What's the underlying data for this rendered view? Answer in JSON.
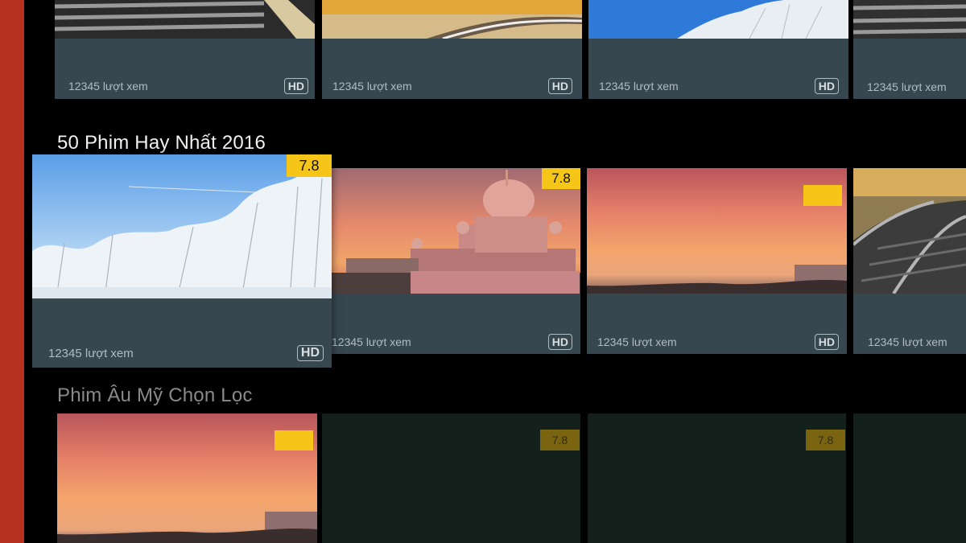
{
  "row0": {
    "cards": [
      {
        "views": "12345 lượt xem",
        "badge": "HD"
      },
      {
        "views": "12345 lượt xem",
        "badge": "HD"
      },
      {
        "views": "12345 lượt xem",
        "badge": "HD"
      },
      {
        "views": "12345 lượt xem"
      }
    ]
  },
  "row1": {
    "title": "50 Phim Hay Nhất 2016",
    "cards": [
      {
        "views": "12345 lượt xem",
        "badge": "HD",
        "rating": "7.8"
      },
      {
        "views": "12345 lượt xem",
        "badge": "HD",
        "rating": "7.8"
      },
      {
        "views": "12345 lượt xem",
        "badge": "HD",
        "rating": ""
      },
      {
        "views": "12345 lượt xem"
      }
    ]
  },
  "row2": {
    "title": "Phim Âu Mỹ Chọn Lọc",
    "cards": [
      {
        "rating": ""
      },
      {
        "rating": "7.8"
      },
      {
        "rating": "7.8"
      },
      {}
    ]
  },
  "colors": {
    "rail": "#b8321f",
    "card": "#37474f",
    "rating_badge": "#f5c518"
  }
}
